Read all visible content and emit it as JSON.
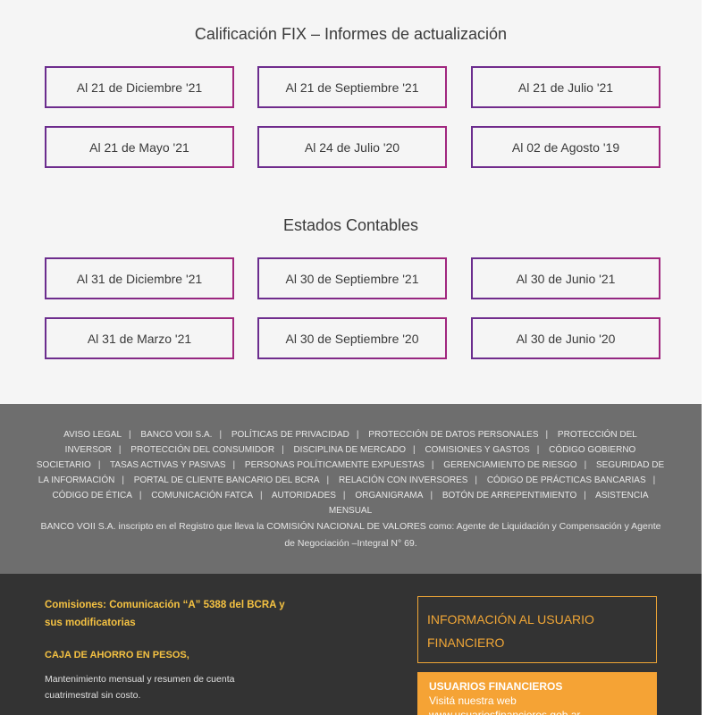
{
  "fix_section": {
    "title": "Calificación FIX – Informes de actualización",
    "buttons": [
      "Al 21 de Diciembre '21",
      "Al 21 de Septiembre '21",
      "Al 21 de Julio '21",
      "Al 21 de Mayo '21",
      "Al 24 de Julio '20",
      "Al 02 de Agosto '19"
    ]
  },
  "accounting_section": {
    "title": "Estados Contables",
    "buttons": [
      "Al 31 de Diciembre '21",
      "Al 30 de Septiembre '21",
      "Al 30 de Junio '21",
      "Al 31 de Marzo '21",
      "Al 30 de Septiembre '20",
      "Al 30 de Junio '20"
    ]
  },
  "footer": {
    "links": [
      "Aviso Legal",
      "Banco VOII S.A.",
      "Políticas de Privacidad",
      "Protección de Datos Personales",
      "Protección del Inversor",
      "Protección del Consumidor",
      "Disciplina de Mercado",
      "Comisiones y Gastos",
      "Código Gobierno Societario",
      "Tasas Activas y Pasivas",
      "Personas Políticamente Expuestas",
      "Gerenciamiento de Riesgo",
      "Seguridad de la Información",
      "Portal de Cliente Bancario del BCRA",
      "Relación con Inversores",
      "Código de Prácticas Bancarias",
      "Código de Ética",
      "Comunicación FATCA",
      "Autoridades",
      "Organigrama",
      "Botón de Arrepentimiento",
      "Asistencia Mensual"
    ],
    "separator": "|",
    "legal_text": "BANCO VOII S.A. inscripto en el Registro que lleva la COMISIÓN NACIONAL DE VALORES como: Agente de Liquidación y Compensación y Agente de Negociación –Integral N° 69.",
    "commissions_title": "Comisiones: Comunicación “A” 5388 del BCRA y sus modificatorias",
    "savings_title": "CAJA DE AHORRO EN PESOS,",
    "savings_text": "Mantenimiento mensual y resumen de cuenta cuatrimestral sin costo.",
    "info_box_label": "Información al Usuario Financiero",
    "usuarios": {
      "title": "USUARIOS FINANCIEROS",
      "subtitle": "Visitá nuestra web",
      "url": "www.usuariosfinancieros.gob.ar"
    }
  },
  "colors": {
    "button_border_start": "#6b2d8e",
    "button_border_end": "#a0267e",
    "footer_grey": "#6e6e6e",
    "footer_dark": "#333333",
    "accent_orange": "#f5a335",
    "accent_yellow": "#f5c242"
  }
}
